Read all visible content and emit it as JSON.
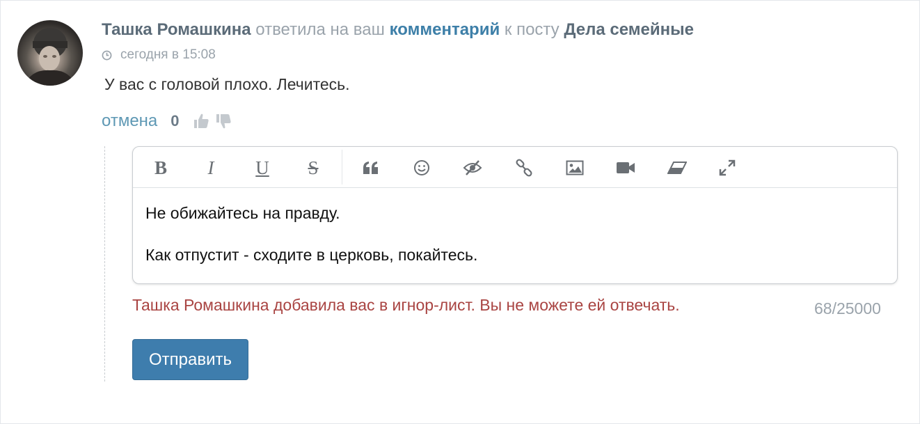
{
  "notification": {
    "author": "Ташка Ромашкина",
    "action_text": "ответила на ваш",
    "link_text": "комментарий",
    "post_prefix": "к посту",
    "post_title": "Дела семейные",
    "time": "сегодня в 15:08",
    "comment": "У вас с головой плохо. Лечитесь."
  },
  "actions": {
    "cancel_label": "отмена",
    "score": "0"
  },
  "toolbar": {
    "tools": [
      "bold",
      "italic",
      "underline",
      "strikethrough",
      "quote-icon",
      "smile-icon",
      "spoiler-icon",
      "link-icon",
      "image-icon",
      "video-icon",
      "eraser-icon",
      "fullscreen-icon"
    ],
    "bold": "B",
    "italic": "I",
    "underline": "U",
    "strike": "S"
  },
  "editor": {
    "line1": "Не обижайтесь на правду.",
    "line2": "Как отпустит - сходите в церковь, покайтесь."
  },
  "ignore_message": "Ташка Ромашкина добавила вас в игнор-лист. Вы не можете ей отвечать.",
  "counter": "68/25000",
  "send_label": "Отправить",
  "colors": {
    "accent": "#3e7dad",
    "error": "#a94442",
    "muted": "#9aa3ab"
  }
}
